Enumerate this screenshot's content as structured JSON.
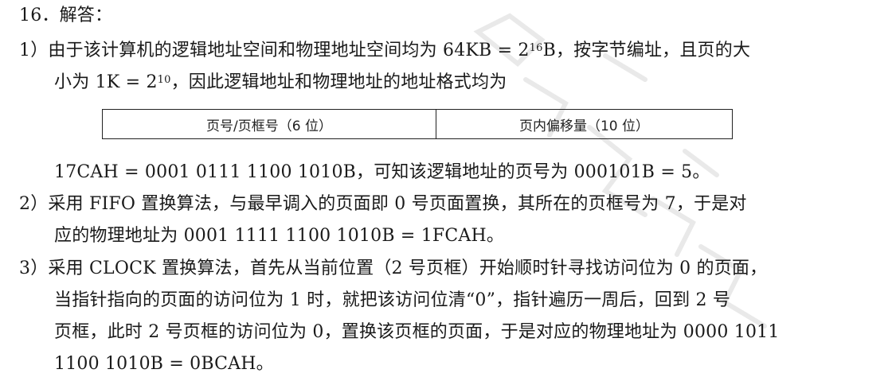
{
  "heading": "16．解答：",
  "p1": {
    "marker": "1）",
    "line1_a": "由于该计算机的逻辑地址空间和物理地址空间均为 64KB = 2",
    "line1_sup": "16",
    "line1_b": "B，按字节编址，且页的大",
    "line2_a": "小为 1K = 2",
    "line2_sup": "10",
    "line2_b": "，因此逻辑地址和物理地址的地址格式均为"
  },
  "table": {
    "left": "页号/页框号（6 位）",
    "right": "页内偏移量（10 位）"
  },
  "p1_tail": "17CAH = 0001 0111 1100 1010B，可知该逻辑地址的页号为 000101B = 5。",
  "p2": {
    "marker": "2）",
    "line1": "采用 FIFO 置换算法，与最早调入的页面即 0 号页面置换，其所在的页框号为 7，于是对",
    "line2": "应的物理地址为 0001 1111 1100 1010B = 1FCAH。"
  },
  "p3": {
    "marker": "3）",
    "line1": "采用 CLOCK 置换算法，首先从当前位置（2 号页框）开始顺时针寻找访问位为 0 的页面，",
    "line2": "当指针指向的页面的访问位为 1 时，就把该访问位清“0”，指针遍历一周后，回到 2 号",
    "line3": "页框，此时 2 号页框的访问位为 0，置换该页框的页面，于是对应的物理地址为 0000 1011",
    "line4": "1100 1010B = 0BCAH。"
  }
}
